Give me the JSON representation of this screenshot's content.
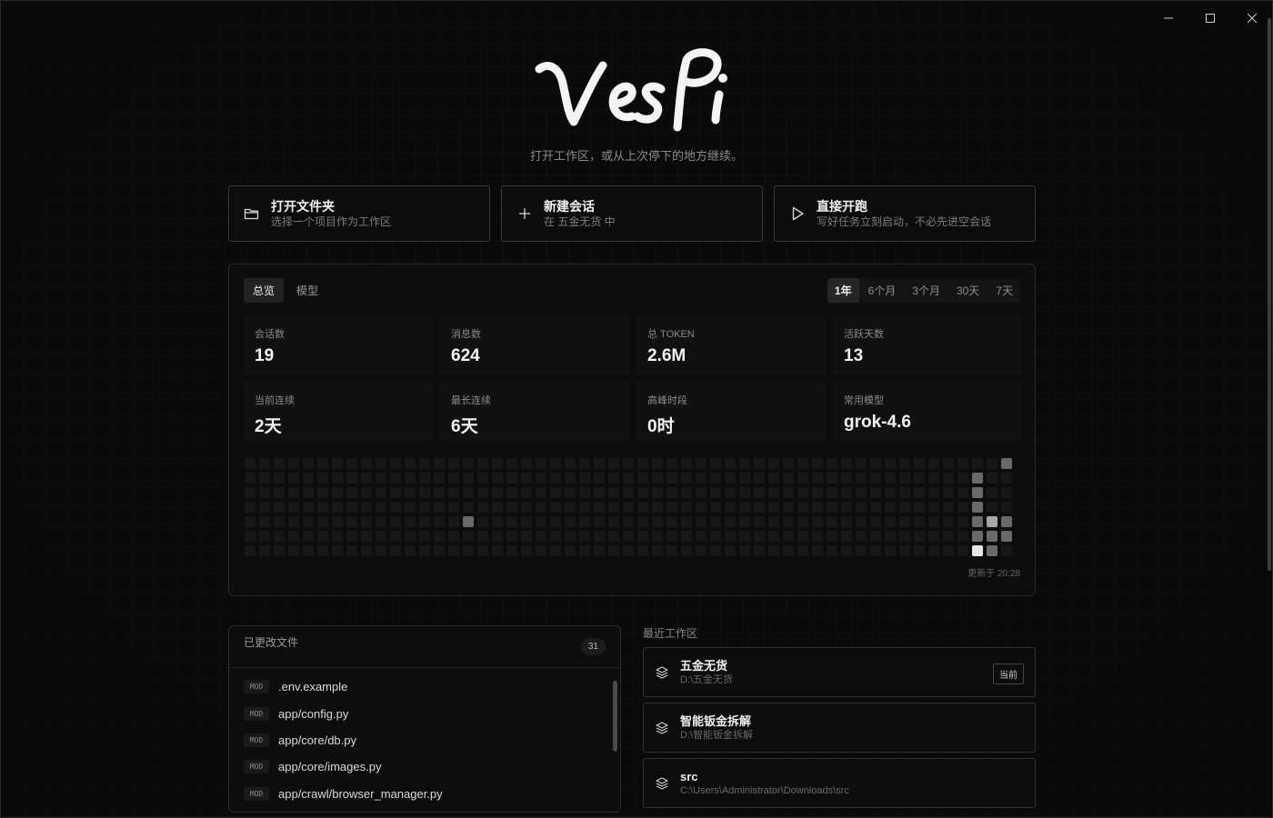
{
  "window": {
    "minimize": "minimize",
    "maximize": "maximize",
    "close": "close"
  },
  "brand": {
    "logo_text": "VesPi"
  },
  "subtitle": "打开工作区，或从上次停下的地方继续。",
  "actions": [
    {
      "icon": "folder-icon",
      "title": "打开文件夹",
      "desc": "选择一个项目作为工作区"
    },
    {
      "icon": "plus-icon",
      "title": "新建会话",
      "desc": "在 五金无货 中"
    },
    {
      "icon": "play-icon",
      "title": "直接开跑",
      "desc": "写好任务立刻启动，不必先进空会话"
    }
  ],
  "stats": {
    "tabs": [
      "总览",
      "模型"
    ],
    "active_tab": "总览",
    "ranges": [
      "1年",
      "6个月",
      "3个月",
      "30天",
      "7天"
    ],
    "active_range": "1年",
    "cards": [
      {
        "label": "会话数",
        "value": "19"
      },
      {
        "label": "消息数",
        "value": "624"
      },
      {
        "label": "总 TOKEN",
        "value": "2.6M"
      },
      {
        "label": "活跃天数",
        "value": "13"
      },
      {
        "label": "当前连续",
        "value": "2天"
      },
      {
        "label": "最长连续",
        "value": "6天"
      },
      {
        "label": "高峰时段",
        "value": "0时"
      },
      {
        "label": "常用模型",
        "value": "grok-4.6"
      }
    ],
    "heatmap": {
      "weeks": 53,
      "days": 7,
      "active": [
        {
          "week": 15,
          "day": 4,
          "level": 2
        },
        {
          "week": 50,
          "day": 1,
          "level": 2
        },
        {
          "week": 50,
          "day": 2,
          "level": 2
        },
        {
          "week": 50,
          "day": 3,
          "level": 2
        },
        {
          "week": 50,
          "day": 4,
          "level": 2
        },
        {
          "week": 50,
          "day": 5,
          "level": 2
        },
        {
          "week": 50,
          "day": 6,
          "level": 4
        },
        {
          "week": 51,
          "day": 4,
          "level": 3
        },
        {
          "week": 51,
          "day": 5,
          "level": 2
        },
        {
          "week": 51,
          "day": 6,
          "level": 2
        },
        {
          "week": 52,
          "day": 0,
          "level": 2
        },
        {
          "week": 52,
          "day": 4,
          "level": 2
        },
        {
          "week": 52,
          "day": 5,
          "level": 2
        }
      ],
      "colors": {
        "empty": "#181818",
        "level1": "#3a3a3a",
        "level2": "#6a6a6a",
        "level3": "#a8a8a8",
        "level4": "#e6e6e6"
      }
    },
    "updated": "更新于 20:28"
  },
  "files": {
    "title": "已更改文件",
    "count": "31",
    "items": [
      {
        "badge": "MOD",
        "name": ".env.example"
      },
      {
        "badge": "MOD",
        "name": "app/config.py"
      },
      {
        "badge": "MOD",
        "name": "app/core/db.py"
      },
      {
        "badge": "MOD",
        "name": "app/core/images.py"
      },
      {
        "badge": "MOD",
        "name": "app/crawl/browser_manager.py"
      }
    ]
  },
  "workspaces": {
    "title": "最近工作区",
    "current_label": "当前",
    "items": [
      {
        "name": "五金无货",
        "path": "D:\\五金无货",
        "current": true
      },
      {
        "name": "智能钣金拆解",
        "path": "D:\\智能钣金拆解",
        "current": false
      },
      {
        "name": "src",
        "path": "C:\\Users\\Administrator\\Downloads\\src",
        "current": false
      }
    ]
  }
}
